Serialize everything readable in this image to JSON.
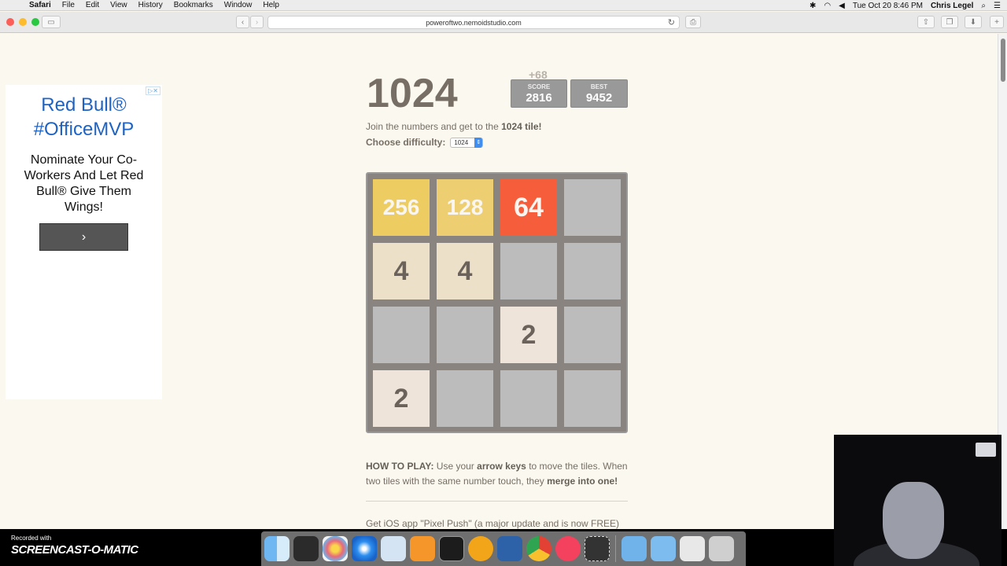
{
  "menubar": {
    "app": "Safari",
    "items": [
      "File",
      "Edit",
      "View",
      "History",
      "Bookmarks",
      "Window",
      "Help"
    ],
    "datetime": "Tue Oct 20  8:46 PM",
    "user": "Chris Legel"
  },
  "browser": {
    "url": "poweroftwo.nemoidstudio.com"
  },
  "ad": {
    "headline": "Red Bull® #OfficeMVP",
    "body": "Nominate Your Co-Workers And Let Red Bull® Give Them Wings!",
    "cta_icon": "chevron-right-icon"
  },
  "game": {
    "title": "1024",
    "score_delta": "+68",
    "score_label": "SCORE",
    "score_value": "2816",
    "best_label": "BEST",
    "best_value": "9452",
    "intro_text": "Join the numbers and get to the ",
    "intro_bold": "1024 tile!",
    "difficulty_label": "Choose difficulty:",
    "difficulty_value": "1024",
    "board": [
      [
        "256",
        "128",
        "64",
        ""
      ],
      [
        "4",
        "4",
        "",
        ""
      ],
      [
        "",
        "",
        "2",
        ""
      ],
      [
        "2",
        "",
        "",
        ""
      ]
    ],
    "howto": {
      "label": "HOW TO PLAY:",
      "text1": " Use your ",
      "keys": "arrow keys",
      "text2": " to move the tiles. When two tiles with the same number touch, they ",
      "merge": "merge into one!"
    },
    "cutoff": "Get iOS app \"Pixel Push\" (a major update and is now FREE)"
  },
  "recording": {
    "line1": "Recorded with",
    "line2": "SCREENCAST-O-MATIC"
  },
  "colors": {
    "tile2": "#eee4da",
    "tile4": "#ede0c8",
    "tile64": "#f65e3b",
    "tile128": "#edcf72",
    "tile256": "#edcc61",
    "empty": "#bcbcbc"
  }
}
